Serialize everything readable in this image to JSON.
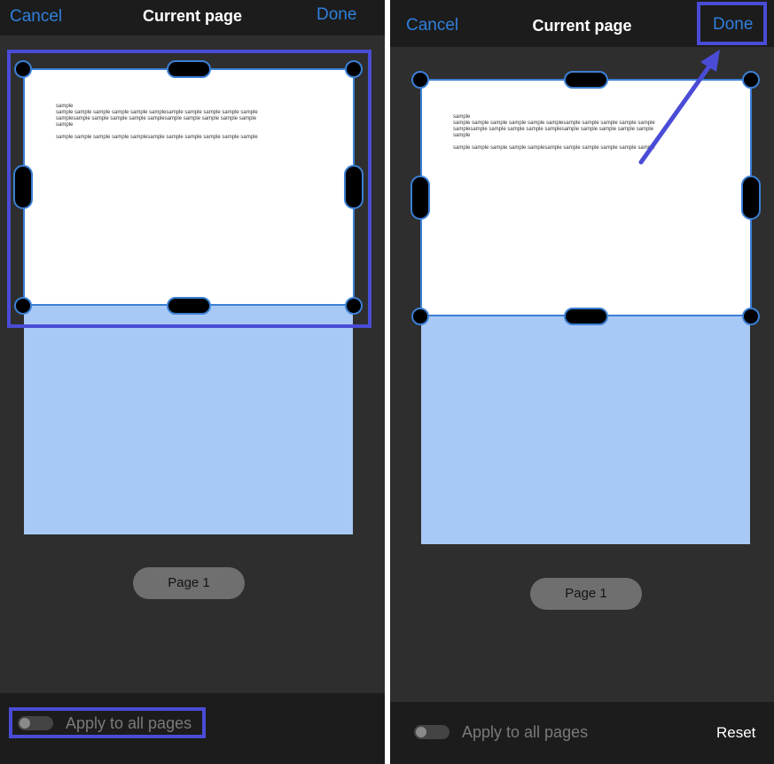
{
  "screens": [
    {
      "header": {
        "cancel_label": "Cancel",
        "title": "Current page",
        "done_label": "Done"
      },
      "document_text": {
        "line1": "sample",
        "line2": "sample sample sample sample sample samplesample sample sample sample sample",
        "line3": "samplesample sample sample sample samplesample sample sample sample sample",
        "line4": "sample",
        "line5": "sample sample sample sample samplesample sample sample sample sample sample"
      },
      "page_indicator": "Page 1",
      "footer": {
        "apply_all_label": "Apply to all pages",
        "apply_all_on": false
      }
    },
    {
      "header": {
        "cancel_label": "Cancel",
        "title": "Current page",
        "done_label": "Done"
      },
      "document_text": {
        "line1": "sample",
        "line2": "sample sample sample sample sample samplesample sample sample sample sample",
        "line3": "samplesample sample sample sample samplesample sample sample sample sample",
        "line4": "sample",
        "line5": "sample sample sample sample samplesample sample sample sample sample sample"
      },
      "page_indicator": "Page 1",
      "footer": {
        "apply_all_label": "Apply to all pages",
        "apply_all_on": false,
        "reset_label": "Reset"
      }
    }
  ],
  "colors": {
    "accent": "#2f7fdc",
    "highlight": "#4a4cd6",
    "page_fill": "#a8c9f5",
    "background": "#2e2e2e"
  }
}
